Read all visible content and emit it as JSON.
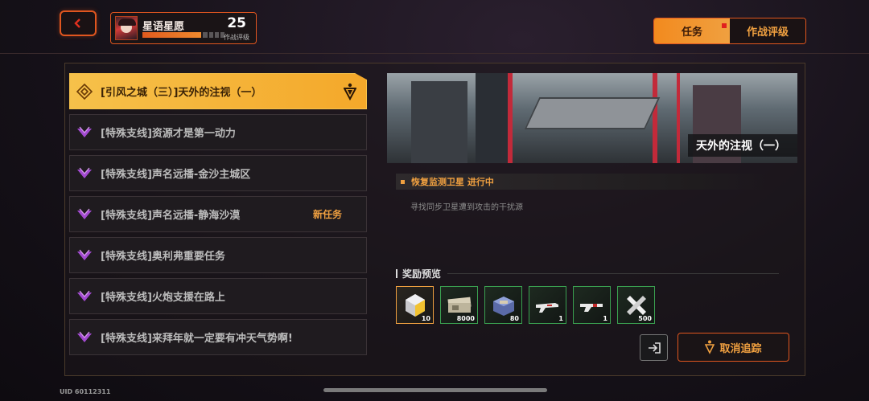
{
  "header": {
    "back_icon": "chevron-left-icon",
    "player": {
      "name": "星语星愿",
      "level": "25",
      "rating_label": "作战评级",
      "progress": 0.72
    },
    "tabs": [
      {
        "label": "任务",
        "active": true,
        "has_badge": true
      },
      {
        "label": "作战评级",
        "active": false
      }
    ]
  },
  "quests": [
    {
      "label": "[引风之城（三）]天外的注视（一）",
      "active": true,
      "tag": "",
      "icon": "main-quest-icon",
      "tracking": true
    },
    {
      "label": "[特殊支线]资源才是第一动力",
      "active": false,
      "tag": "",
      "icon": "side-quest-icon"
    },
    {
      "label": "[特殊支线]声名远播-金沙主城区",
      "active": false,
      "tag": "",
      "icon": "side-quest-icon"
    },
    {
      "label": "[特殊支线]声名远播-静海沙漠",
      "active": false,
      "tag": "新任务",
      "icon": "side-quest-icon"
    },
    {
      "label": "[特殊支线]奥利弗重要任务",
      "active": false,
      "tag": "",
      "icon": "side-quest-icon"
    },
    {
      "label": "[特殊支线]火炮支援在路上",
      "active": false,
      "tag": "",
      "icon": "side-quest-icon"
    },
    {
      "label": "[特殊支线]来拜年就一定要有冲天气势啊!",
      "active": false,
      "tag": "",
      "icon": "side-quest-icon"
    }
  ],
  "detail": {
    "banner_title": "天外的注视（一）",
    "objective": "恢复监测卫星  进行中",
    "objective_desc": "寻找同步卫星遭到攻击的干扰源",
    "reward_header": "奖励预览",
    "rewards": [
      {
        "icon": "crystal-cube-icon",
        "count": "10",
        "rarity": "gold"
      },
      {
        "icon": "cash-bundle-icon",
        "count": "8000",
        "rarity": "green"
      },
      {
        "icon": "supply-box-icon",
        "count": "80",
        "rarity": "green"
      },
      {
        "icon": "rifle-icon",
        "count": "1",
        "rarity": "green"
      },
      {
        "icon": "shotgun-icon",
        "count": "1",
        "rarity": "green"
      },
      {
        "icon": "crossed-tools-icon",
        "count": "500",
        "rarity": "green"
      }
    ],
    "navigate_icon": "enter-door-icon",
    "cancel_label": "取消追踪"
  },
  "footer": {
    "uid": "UID 60112311"
  },
  "colors": {
    "accent": "#e0561f",
    "gold": "#f4b13a",
    "orange_text": "#f0a040"
  }
}
